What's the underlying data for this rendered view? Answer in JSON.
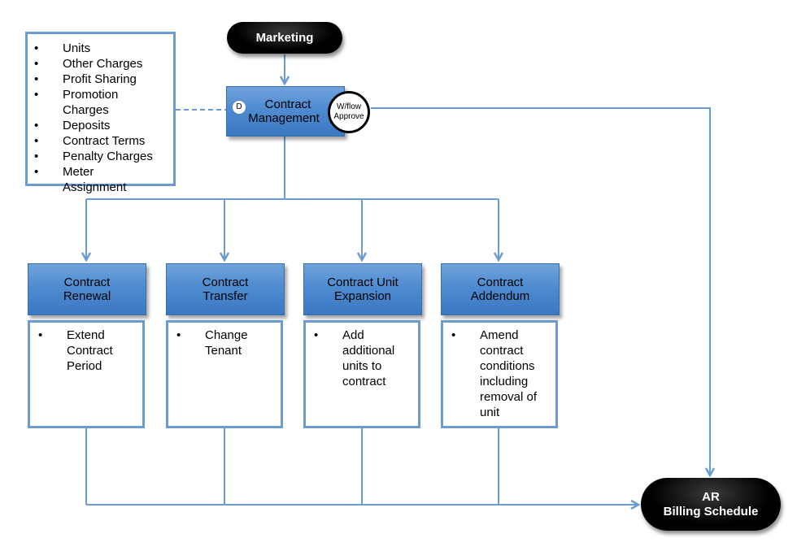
{
  "diagram": {
    "start_node": {
      "label": "Marketing"
    },
    "main_process": {
      "label_line1": "Contract",
      "label_line2": "Management",
      "badge": "D",
      "approval": {
        "line1": "W/flow",
        "line2": "Approve"
      }
    },
    "data_items": [
      "Units",
      "Other Charges",
      "Profit Sharing",
      "Promotion Charges",
      "Deposits",
      "Contract Terms",
      "Penalty Charges",
      "Meter Assignment"
    ],
    "sub_processes": [
      {
        "title_line1": "Contract",
        "title_line2": "Renewal",
        "description": "Extend Contract Period"
      },
      {
        "title_line1": "Contract",
        "title_line2": "Transfer",
        "description": "Change Tenant"
      },
      {
        "title_line1": "Contract Unit",
        "title_line2": "Expansion",
        "description": "Add additional units to contract"
      },
      {
        "title_line1": "Contract",
        "title_line2": "Addendum",
        "description": "Amend contract conditions including removal of unit"
      }
    ],
    "end_node": {
      "label_line1": "AR",
      "label_line2": "Billing Schedule"
    },
    "bullet_char": "•",
    "colors": {
      "connector": "#6a9bd1",
      "process_fill": "#4f8bd0",
      "terminal_fill": "#000000"
    }
  }
}
